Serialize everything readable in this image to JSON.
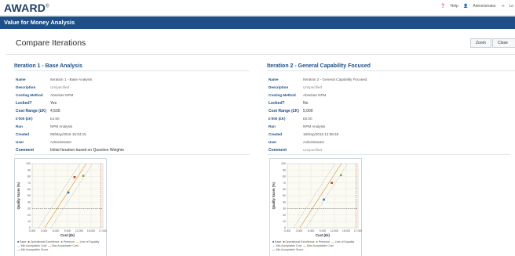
{
  "app": {
    "logo": "AWARD",
    "logo_mark": "®",
    "nav": {
      "help": "Help",
      "user": "Administrator",
      "logout": "Lo"
    },
    "section_title": "Value for Money Analysis"
  },
  "page": {
    "title": "Compare Iterations",
    "zoom_label": "Zoom",
    "close_label": "Close"
  },
  "labels": {
    "name": "Name",
    "description": "Description",
    "costing_method": "Costing Method",
    "locked": "Locked?",
    "cost_range": "Cost Range (£K)",
    "cost_hint": "£'000 (£K)",
    "run": "Run",
    "created": "Created",
    "user": "User",
    "comment": "Comment"
  },
  "iterations": [
    {
      "heading": "Iteration 1 - Base Analysis",
      "name": "Iteration 1 - Base Analysis",
      "description": "Unspecified",
      "costing_method": "Absolute NPM",
      "locked": "Yes",
      "cost_range": "4,500",
      "cost_hint": "£4.50",
      "run": "NPM Analysis",
      "created": "06/May/2016 15:04:15",
      "user": "Administrator",
      "comment": "Initial Iteration based on Question Weights"
    },
    {
      "heading": "Iteration 2 - General Capability Focused",
      "name": "Iteration 2 - General Capability Focused",
      "description": "Unspecified",
      "costing_method": "Absolute NPM",
      "locked": "No",
      "cost_range": "5,000",
      "cost_hint": "£5.00",
      "run": "NPM Analysis",
      "created": "19/Sep/2016 12:38:49",
      "user": "Administrator",
      "comment": "Unspecified"
    }
  ],
  "chart_data": [
    {
      "type": "scatter",
      "title": "",
      "xlabel": "Cost (£k)",
      "ylabel": "Quality Score (%)",
      "xlim": [
        0,
        17000
      ],
      "ylim": [
        0,
        100
      ],
      "xticks": [
        "0.000",
        "3.000",
        "6.000",
        "9.000",
        "12.000",
        "15.000",
        "17.000"
      ],
      "yticks": [
        "0",
        "10",
        "20",
        "30",
        "40",
        "50",
        "60",
        "70",
        "80",
        "90",
        "100"
      ],
      "points": [
        {
          "name": "Base",
          "x": 8700,
          "y": 55,
          "color": "#2e6fb8"
        },
        {
          "name": "Operational Excellence",
          "x": 10200,
          "y": 79,
          "color": "#c0392b"
        },
        {
          "name": "Premium",
          "x": 12300,
          "y": 81,
          "color": "#7fa832"
        }
      ],
      "legend": [
        "Base",
        "Operational Excellence",
        "Premium",
        "Line of Equality",
        "Min Acceptable Cost",
        "Max Acceptable Cost",
        "Min Acceptable Score"
      ],
      "legend_colors": [
        "#2e6fb8",
        "#c0392b",
        "#7fa832",
        "#d98a2b",
        "#9aa0a6",
        "#c0392b",
        "#555555"
      ]
    },
    {
      "type": "scatter",
      "title": "",
      "xlabel": "Cost (£k)",
      "ylabel": "Quality Score (%)",
      "xlim": [
        0,
        17000
      ],
      "ylim": [
        0,
        100
      ],
      "xticks": [
        "0.000",
        "3.000",
        "6.000",
        "9.000",
        "12.000",
        "15.000",
        "17.000"
      ],
      "yticks": [
        "0",
        "10",
        "20",
        "30",
        "40",
        "50",
        "60",
        "70",
        "80",
        "90",
        "100"
      ],
      "points": [
        {
          "name": "Base",
          "x": 8800,
          "y": 44,
          "color": "#2e6fb8"
        },
        {
          "name": "Operational Excellence",
          "x": 10700,
          "y": 70,
          "color": "#c0392b"
        },
        {
          "name": "Premium",
          "x": 12900,
          "y": 82,
          "color": "#7fa832"
        }
      ],
      "legend": [
        "Base",
        "Operational Excellence",
        "Premium",
        "Line of Equality",
        "Min Acceptable Cost",
        "Max Acceptable Cost",
        "Min Acceptable Score"
      ],
      "legend_colors": [
        "#2e6fb8",
        "#c0392b",
        "#7fa832",
        "#d98a2b",
        "#9aa0a6",
        "#c0392b",
        "#555555"
      ]
    }
  ]
}
